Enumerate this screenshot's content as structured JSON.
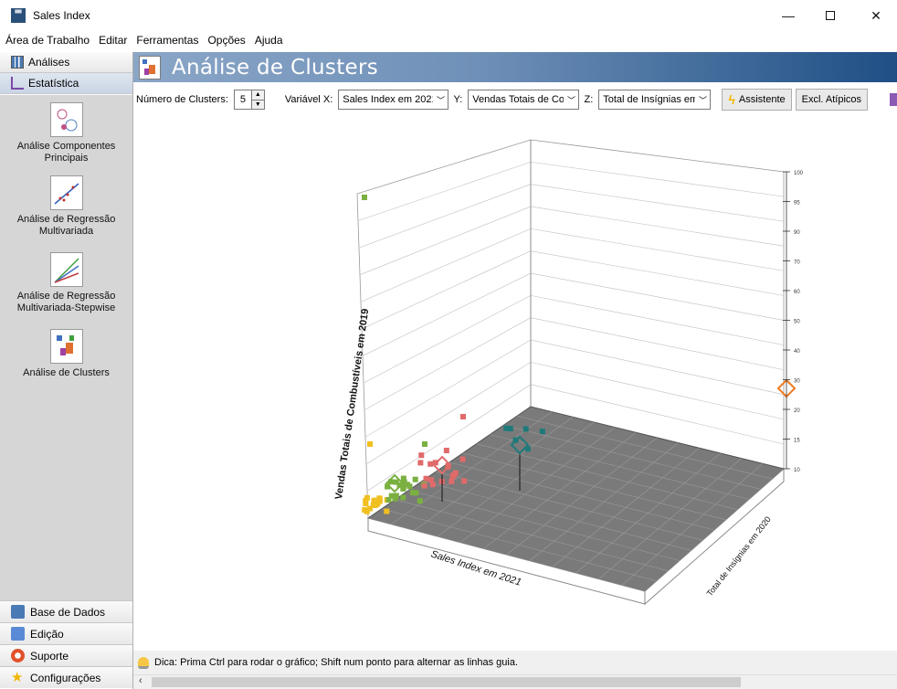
{
  "window": {
    "title": "Sales Index",
    "icon": "app-grid-icon"
  },
  "menu": [
    "Área de Trabalho",
    "Editar",
    "Ferramentas",
    "Opções",
    "Ajuda"
  ],
  "sidebar": {
    "tabs": [
      {
        "label": "Análises",
        "icon": "bar-chart-icon"
      },
      {
        "label": "Estatística",
        "icon": "line-chart-icon",
        "selected": true
      }
    ],
    "tools": [
      {
        "label": "Análise Componentes Principais",
        "icon": "pca-icon"
      },
      {
        "label": "Análise de Regressão Multivariada",
        "icon": "regression-icon"
      },
      {
        "label": "Análise de Regressão Multivariada-Stepwise",
        "icon": "stepwise-regression-icon"
      },
      {
        "label": "Análise de Clusters",
        "icon": "clusters-icon"
      }
    ],
    "bottom": [
      {
        "label": "Base de Dados",
        "icon": "database-icon",
        "color": "#4a7ab5"
      },
      {
        "label": "Edição",
        "icon": "edit-icon",
        "color": "#5a8ad5"
      },
      {
        "label": "Suporte",
        "icon": "lifebuoy-icon",
        "color": "#e0522a"
      },
      {
        "label": "Configurações",
        "icon": "star-icon",
        "color": "#f2b600"
      }
    ]
  },
  "header": {
    "title": "Análise de Clusters"
  },
  "toolbar": {
    "clusters_label": "Número de Clusters:",
    "clusters_value": "5",
    "x_label": "Variável X:",
    "x_value": "Sales Index em 2021",
    "y_label": "Y:",
    "y_value": "Vendas Totais de Combustíveis em 2019",
    "z_label": "Z:",
    "z_value": "Total de Insígnias em 2020",
    "assistant_label": "Assistente",
    "outliers_label": "Excl. Atípicos"
  },
  "chart_data": {
    "type": "scatter",
    "dimensions": 3,
    "xlabel": "Sales Index em 2021",
    "ylabel": "Vendas Totais de Combustíveis em 2019",
    "zlabel": "Total de Insígnias em 2020",
    "right_axis_ticks": [
      "100",
      "95",
      "90",
      "70",
      "60",
      "50",
      "40",
      "30",
      "20",
      "15",
      "10"
    ],
    "background": "#7a7a7a",
    "clusters": [
      {
        "color": "#f0c020",
        "name": ""
      },
      {
        "color": "#7ab040",
        "name": ""
      },
      {
        "color": "#e06a6a",
        "name": ""
      },
      {
        "color": "#1f7a7a",
        "name": ""
      },
      {
        "color": "#f07a20",
        "name": ""
      }
    ]
  },
  "status": {
    "tip": "Dica: Prima Ctrl para rodar o gráfico; Shift num ponto para alternar as linhas guia."
  }
}
